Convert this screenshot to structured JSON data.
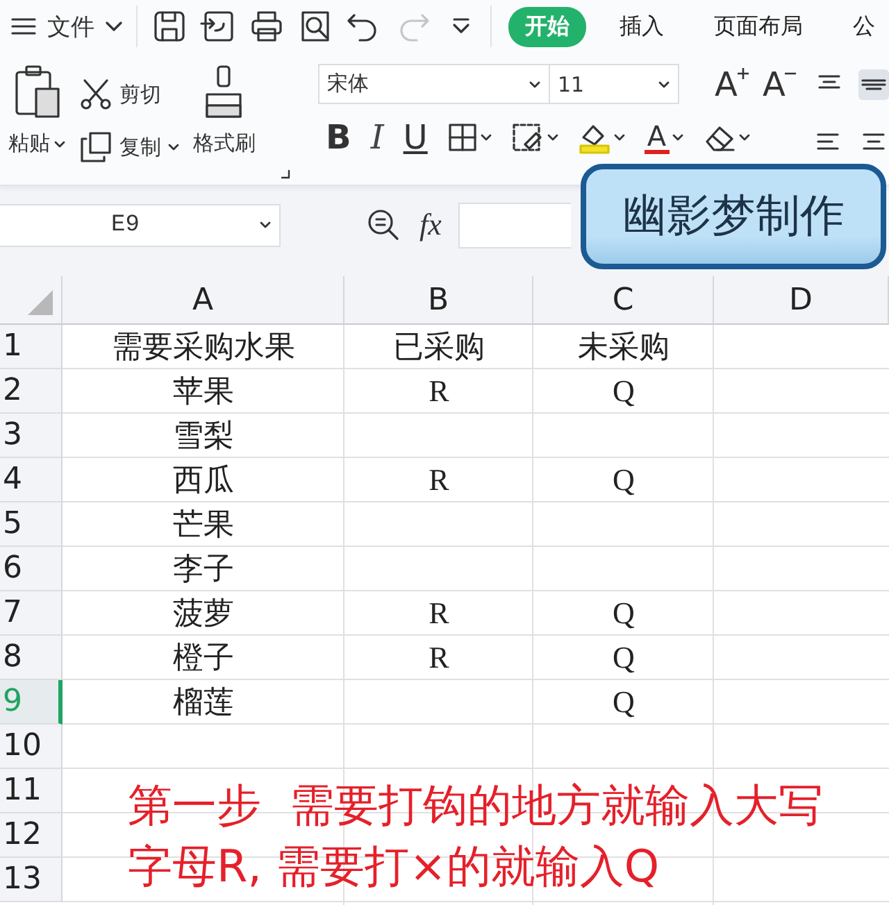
{
  "menu": {
    "label": "文件"
  },
  "quick_access": [
    {
      "kind": "save",
      "disabled": false
    },
    {
      "kind": "export",
      "disabled": false
    },
    {
      "kind": "print",
      "disabled": false
    },
    {
      "kind": "preview",
      "disabled": false
    },
    {
      "kind": "undo",
      "disabled": false
    },
    {
      "kind": "redo",
      "disabled": true
    },
    {
      "kind": "more",
      "disabled": false
    }
  ],
  "tabs": [
    {
      "label": "开始",
      "selected": true
    },
    {
      "label": "插入",
      "selected": false
    },
    {
      "label": "页面布局",
      "selected": false
    },
    {
      "label": "公",
      "selected": false
    }
  ],
  "clipboard": {
    "paste": "粘贴",
    "cut": "剪切",
    "copy": "复制",
    "format_painter": "格式刷"
  },
  "font": {
    "name": "宋体",
    "size": "11",
    "grow": "A",
    "shrink": "A",
    "bold": "B",
    "italic": "I",
    "underline": "U",
    "font_color": "A"
  },
  "formula_bar": {
    "name_box": "E9",
    "fx": "fx"
  },
  "badge": "幽影梦制作",
  "sheet": {
    "columns": [
      "A",
      "B",
      "C",
      "D"
    ],
    "rows": [
      {
        "number": "1",
        "selected": false,
        "cells": [
          "需要采购水果",
          "已采购",
          "未采购"
        ]
      },
      {
        "number": "2",
        "selected": false,
        "cells": [
          "苹果",
          "R",
          "Q"
        ]
      },
      {
        "number": "3",
        "selected": false,
        "cells": [
          "雪梨",
          "",
          ""
        ]
      },
      {
        "number": "4",
        "selected": false,
        "cells": [
          "西瓜",
          "R",
          "Q"
        ]
      },
      {
        "number": "5",
        "selected": false,
        "cells": [
          "芒果",
          "",
          ""
        ]
      },
      {
        "number": "6",
        "selected": false,
        "cells": [
          "李子",
          "",
          ""
        ]
      },
      {
        "number": "7",
        "selected": false,
        "cells": [
          "菠萝",
          "R",
          "Q"
        ]
      },
      {
        "number": "8",
        "selected": false,
        "cells": [
          "橙子",
          "R",
          "Q"
        ]
      },
      {
        "number": "9",
        "selected": true,
        "cells": [
          "榴莲",
          "",
          "Q"
        ]
      },
      {
        "number": "10",
        "selected": false,
        "cells": [
          "",
          "",
          ""
        ]
      },
      {
        "number": "11",
        "selected": false,
        "cells": [
          "",
          "",
          ""
        ]
      },
      {
        "number": "12",
        "selected": false,
        "cells": [
          "",
          "",
          ""
        ]
      },
      {
        "number": "13",
        "selected": false,
        "cells": [
          "",
          "",
          ""
        ]
      }
    ]
  },
  "note": [
    "第一步  需要打钩的地方就输入大写",
    "字母R, 需要打×的就输入Q"
  ]
}
